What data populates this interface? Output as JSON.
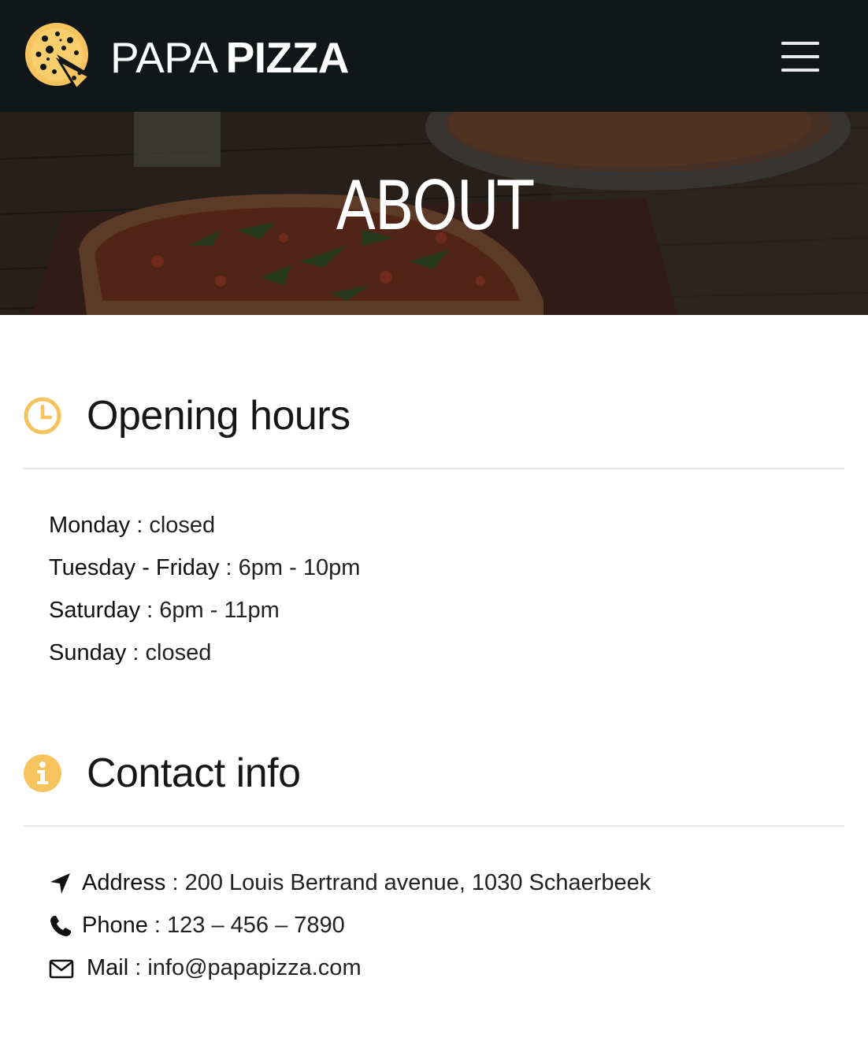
{
  "header": {
    "brand_light": "PAPA",
    "brand_bold": "PIZZA",
    "logo_icon": "pizza-slice-logo",
    "menu_icon": "hamburger-menu-icon",
    "background_color": "#111718",
    "accent_color": "#f6c35e"
  },
  "hero": {
    "title": "ABOUT"
  },
  "opening_hours": {
    "title": "Opening hours",
    "icon": "clock-icon",
    "rows": [
      {
        "day": "Monday",
        "sep": " : ",
        "value": "closed"
      },
      {
        "day": "Tuesday - Friday",
        "sep": " : ",
        "value": "6pm - 10pm"
      },
      {
        "day": "Saturday",
        "sep": " : ",
        "value": "6pm - 11pm"
      },
      {
        "day": "Sunday",
        "sep": " : ",
        "value": "closed"
      }
    ]
  },
  "contact": {
    "title": "Contact info",
    "icon": "info-icon",
    "address_label": "Address",
    "address_value": "200 Louis Bertrand avenue, 1030 Schaerbeek",
    "phone_label": "Phone",
    "phone_value": "123 – 456 – 7890",
    "mail_label": "Mail",
    "mail_value": "info@papapizza.com",
    "sep": " : "
  }
}
